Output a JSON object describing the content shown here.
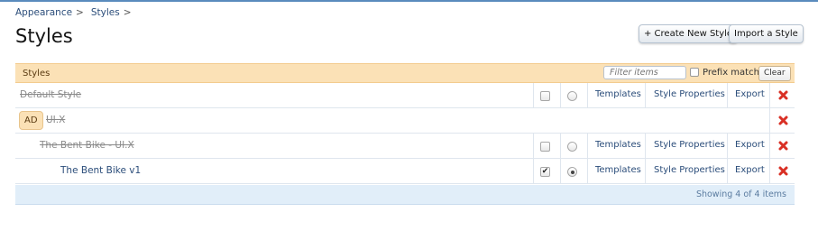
{
  "breadcrumb": [
    {
      "label": "Appearance",
      "sep": ">"
    },
    {
      "label": "Styles",
      "sep": ">"
    }
  ],
  "page_title": "Styles",
  "actions": {
    "create": "+ Create New Style",
    "import": "Import a Style"
  },
  "panel": {
    "title": "Styles",
    "filter_placeholder": "Filter items",
    "prefix_match_label": "Prefix match",
    "clear_label": "Clear"
  },
  "rows": [
    {
      "name": "Default Style",
      "disabled": true,
      "checked": false,
      "radio": false,
      "templates": "Templates",
      "properties": "Style Properties",
      "export": "Export"
    },
    {
      "badge": "AD",
      "name": "UI.X",
      "disabled": true
    },
    {
      "name": "The Bent Bike - UI.X",
      "disabled": true,
      "checked": false,
      "radio": false,
      "templates": "Templates",
      "properties": "Style Properties",
      "export": "Export"
    },
    {
      "name": "The Bent Bike v1",
      "disabled": false,
      "checked": true,
      "radio": true,
      "templates": "Templates",
      "properties": "Style Properties",
      "export": "Export"
    }
  ],
  "footer": {
    "showing": "Showing 4 of 4 items"
  },
  "icons": {
    "delete": "delete-x-icon",
    "delete_color": "#d93025"
  }
}
